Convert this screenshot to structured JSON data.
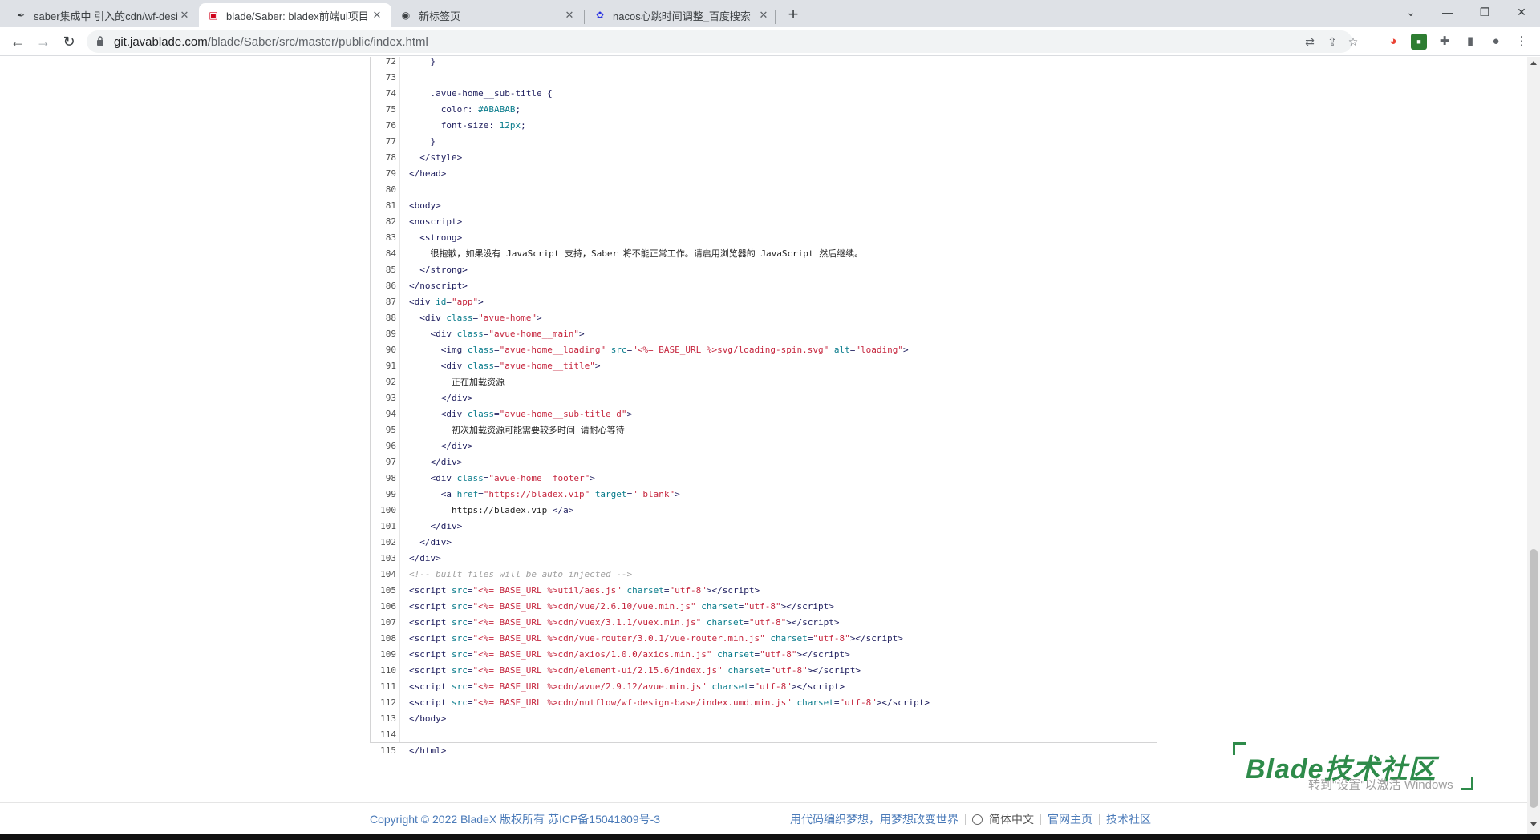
{
  "browser": {
    "tabs": [
      {
        "title": "saber集成中 引入的cdn/wf-desi",
        "favicon": "quill-icon",
        "active": false
      },
      {
        "title": "blade/Saber: bladex前端ui项目",
        "favicon": "bladex-icon",
        "active": true
      },
      {
        "title": "新标签页",
        "favicon": "chrome-icon",
        "active": false
      },
      {
        "title": "nacos心跳时间调整_百度搜索",
        "favicon": "baidu-paw-icon",
        "active": false
      }
    ],
    "url_host": "git.javablade.com",
    "url_path": "/blade/Saber/src/master/public/index.html"
  },
  "code": {
    "lines": [
      {
        "n": "72",
        "html": "    }"
      },
      {
        "n": "73",
        "html": ""
      },
      {
        "n": "74",
        "html": "    .avue-home__sub-title {"
      },
      {
        "n": "75",
        "html": "      color: <span class=\"num\">#ABABAB</span>;"
      },
      {
        "n": "76",
        "html": "      font-size: <span class=\"num\">12px</span>;"
      },
      {
        "n": "77",
        "html": "    }"
      },
      {
        "n": "78",
        "html": "  &lt;/style&gt;"
      },
      {
        "n": "79",
        "html": "&lt;/head&gt;"
      },
      {
        "n": "80",
        "html": ""
      },
      {
        "n": "81",
        "html": "&lt;body&gt;"
      },
      {
        "n": "82",
        "html": "&lt;noscript&gt;"
      },
      {
        "n": "83",
        "html": "  &lt;strong&gt;"
      },
      {
        "n": "84",
        "html": "    <span class=\"txt\">很抱歉，如果没有 JavaScript 支持，Saber 将不能正常工作。请启用浏览器的 JavaScript 然后继续。</span>"
      },
      {
        "n": "85",
        "html": "  &lt;/strong&gt;"
      },
      {
        "n": "86",
        "html": "&lt;/noscript&gt;"
      },
      {
        "n": "87",
        "html": "&lt;div <span class=\"attr\">id</span>=<span class=\"str\">\"app\"</span>&gt;"
      },
      {
        "n": "88",
        "html": "  &lt;div <span class=\"attr\">class</span>=<span class=\"str\">\"avue-home\"</span>&gt;"
      },
      {
        "n": "89",
        "html": "    &lt;div <span class=\"attr\">class</span>=<span class=\"str\">\"avue-home__main\"</span>&gt;"
      },
      {
        "n": "90",
        "html": "      &lt;img <span class=\"attr\">class</span>=<span class=\"str\">\"avue-home__loading\"</span> <span class=\"attr\">src</span>=<span class=\"str\">\"&lt;%= BASE_URL %&gt;svg/loading-spin.svg\"</span> <span class=\"attr\">alt</span>=<span class=\"str\">\"loading\"</span>&gt;"
      },
      {
        "n": "91",
        "html": "      &lt;div <span class=\"attr\">class</span>=<span class=\"str\">\"avue-home__title\"</span>&gt;"
      },
      {
        "n": "92",
        "html": "        <span class=\"txt\">正在加载资源</span>"
      },
      {
        "n": "93",
        "html": "      &lt;/div&gt;"
      },
      {
        "n": "94",
        "html": "      &lt;div <span class=\"attr\">class</span>=<span class=\"str\">\"avue-home__sub-title d\"</span>&gt;"
      },
      {
        "n": "95",
        "html": "        <span class=\"txt\">初次加载资源可能需要较多时间 请耐心等待</span>"
      },
      {
        "n": "96",
        "html": "      &lt;/div&gt;"
      },
      {
        "n": "97",
        "html": "    &lt;/div&gt;"
      },
      {
        "n": "98",
        "html": "    &lt;div <span class=\"attr\">class</span>=<span class=\"str\">\"avue-home__footer\"</span>&gt;"
      },
      {
        "n": "99",
        "html": "      &lt;a <span class=\"attr\">href</span>=<span class=\"str\">\"https://bladex.vip\"</span> <span class=\"attr\">target</span>=<span class=\"str\">\"_blank\"</span>&gt;"
      },
      {
        "n": "100",
        "html": "        <span class=\"txt\">https://bladex.vip </span>&lt;/a&gt;"
      },
      {
        "n": "101",
        "html": "    &lt;/div&gt;"
      },
      {
        "n": "102",
        "html": "  &lt;/div&gt;"
      },
      {
        "n": "103",
        "html": "&lt;/div&gt;"
      },
      {
        "n": "104",
        "html": "<span class=\"cmt\">&lt;!-- built files will be auto injected --&gt;</span>"
      },
      {
        "n": "105",
        "html": "&lt;script <span class=\"attr\">src</span>=<span class=\"str\">\"&lt;%= BASE_URL %&gt;util/aes.js\"</span> <span class=\"attr\">charset</span>=<span class=\"str\">\"utf-8\"</span>&gt;&lt;/script&gt;"
      },
      {
        "n": "106",
        "html": "&lt;script <span class=\"attr\">src</span>=<span class=\"str\">\"&lt;%= BASE_URL %&gt;cdn/vue/2.6.10/vue.min.js\"</span> <span class=\"attr\">charset</span>=<span class=\"str\">\"utf-8\"</span>&gt;&lt;/script&gt;"
      },
      {
        "n": "107",
        "html": "&lt;script <span class=\"attr\">src</span>=<span class=\"str\">\"&lt;%= BASE_URL %&gt;cdn/vuex/3.1.1/vuex.min.js\"</span> <span class=\"attr\">charset</span>=<span class=\"str\">\"utf-8\"</span>&gt;&lt;/script&gt;"
      },
      {
        "n": "108",
        "html": "&lt;script <span class=\"attr\">src</span>=<span class=\"str\">\"&lt;%= BASE_URL %&gt;cdn/vue-router/3.0.1/vue-router.min.js\"</span> <span class=\"attr\">charset</span>=<span class=\"str\">\"utf-8\"</span>&gt;&lt;/script&gt;"
      },
      {
        "n": "109",
        "html": "&lt;script <span class=\"attr\">src</span>=<span class=\"str\">\"&lt;%= BASE_URL %&gt;cdn/axios/1.0.0/axios.min.js\"</span> <span class=\"attr\">charset</span>=<span class=\"str\">\"utf-8\"</span>&gt;&lt;/script&gt;"
      },
      {
        "n": "110",
        "html": "&lt;script <span class=\"attr\">src</span>=<span class=\"str\">\"&lt;%= BASE_URL %&gt;cdn/element-ui/2.15.6/index.js\"</span> <span class=\"attr\">charset</span>=<span class=\"str\">\"utf-8\"</span>&gt;&lt;/script&gt;"
      },
      {
        "n": "111",
        "html": "&lt;script <span class=\"attr\">src</span>=<span class=\"str\">\"&lt;%= BASE_URL %&gt;cdn/avue/2.9.12/avue.min.js\"</span> <span class=\"attr\">charset</span>=<span class=\"str\">\"utf-8\"</span>&gt;&lt;/script&gt;"
      },
      {
        "n": "112",
        "html": "&lt;script <span class=\"attr\">src</span>=<span class=\"str\">\"&lt;%= BASE_URL %&gt;cdn/nutflow/wf-design-base/index.umd.min.js\"</span> <span class=\"attr\">charset</span>=<span class=\"str\">\"utf-8\"</span>&gt;&lt;/script&gt;"
      },
      {
        "n": "113",
        "html": "&lt;/body&gt;"
      },
      {
        "n": "114",
        "html": ""
      },
      {
        "n": "115",
        "html": "&lt;/html&gt;"
      }
    ]
  },
  "footer": {
    "copyright": "Copyright © 2022 BladeX 版权所有 苏ICP备15041809号-3",
    "slogan": "用代码编织梦想，用梦想改变世界",
    "language": "简体中文",
    "homepage": "官网主页",
    "community": "技术社区"
  },
  "watermark": {
    "brand": "Blade技术社区",
    "activation_hint": "转到\"设置\"以激活 Windows"
  }
}
